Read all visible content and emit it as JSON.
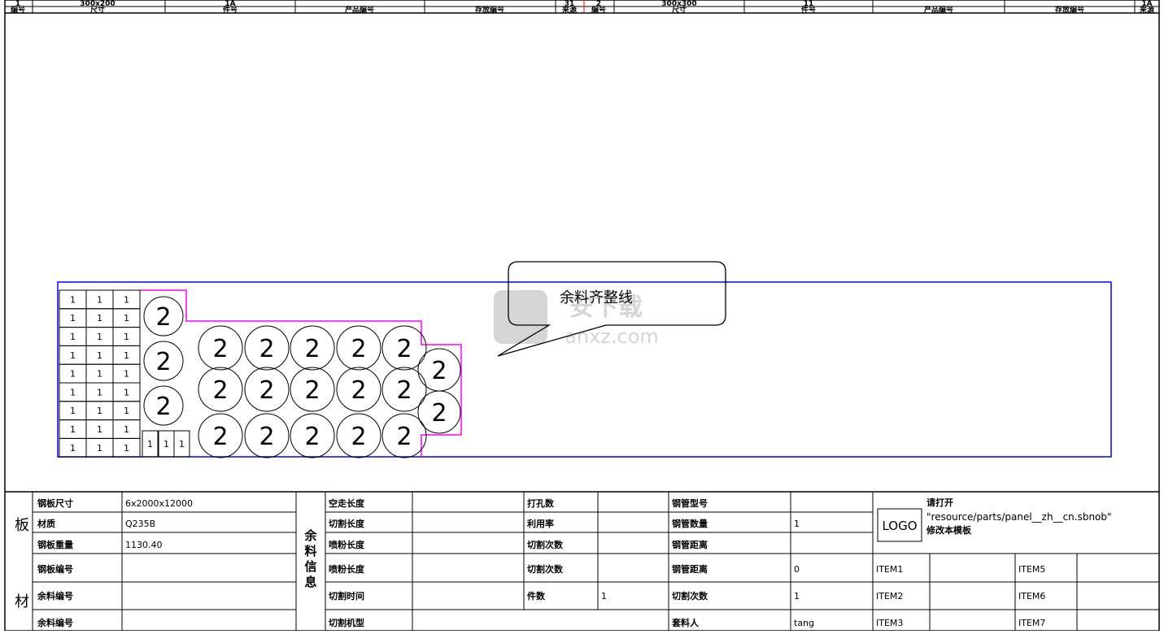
{
  "header": {
    "top_row": [
      {
        "text": "1"
      },
      {
        "text": "300x200"
      },
      {
        "text": "1A"
      },
      {
        "text": "31"
      },
      {
        "text": "2"
      },
      {
        "text": "300x300"
      },
      {
        "text": "11"
      },
      {
        "text": "1A"
      }
    ],
    "columns": [
      {
        "text": "编号"
      },
      {
        "text": "尺寸"
      },
      {
        "text": "件号"
      },
      {
        "text": "产品编号"
      },
      {
        "text": "存放编号"
      },
      {
        "text": "来源"
      },
      {
        "text": "编号"
      },
      {
        "text": "尺寸"
      },
      {
        "text": "件号"
      },
      {
        "text": "产品编号"
      },
      {
        "text": "存放编号"
      },
      {
        "text": "来源"
      }
    ]
  },
  "nesting": {
    "small_label": "1",
    "round_label": "2",
    "callout": "余料齐整线",
    "watermark_main": "安下载",
    "watermark_sub": "anxz.com"
  },
  "info_table": {
    "side_label_top": "板",
    "side_label_bottom": "材",
    "mid_label": [
      "余",
      "料",
      "信",
      "息"
    ],
    "left": [
      {
        "label": "钢板尺寸",
        "value": "6x2000x12000"
      },
      {
        "label": "材质",
        "value": "Q235B"
      },
      {
        "label": "钢板重量",
        "value": "1130.40"
      },
      {
        "label": "钢板编号",
        "value": ""
      },
      {
        "label": "余料编号",
        "value": ""
      }
    ],
    "middle1": [
      {
        "label": "空走长度",
        "value": ""
      },
      {
        "label": "切割长度",
        "value": ""
      },
      {
        "label": "喷粉长度",
        "value": ""
      },
      {
        "label": "切割时间",
        "value": ""
      },
      {
        "label": "切割机型",
        "value": ""
      }
    ],
    "middle2": [
      {
        "label": "打孔数",
        "value": ""
      },
      {
        "label": "利用率",
        "value": ""
      },
      {
        "label": "切割次数",
        "value": ""
      },
      {
        "label": "件数",
        "value": "1"
      }
    ],
    "middle3": [
      {
        "label": "钢管型号",
        "value": ""
      },
      {
        "label": "钢管数量",
        "value": "1"
      },
      {
        "label": "钢管距离",
        "value": "0"
      },
      {
        "label": "切割次数",
        "value": "1"
      },
      {
        "label": "套料人",
        "value": "tang"
      }
    ],
    "logo": "LOGO",
    "logo_note_1": "请打开",
    "logo_note_2": "\"resource/parts/panel__zh__cn.sbnob\"",
    "logo_note_3": "修改本模板",
    "items": [
      {
        "label": "ITEM1",
        "value": ""
      },
      {
        "label": "ITEM2",
        "value": ""
      },
      {
        "label": "ITEM3",
        "value": ""
      },
      {
        "label": "ITEM5",
        "value": ""
      },
      {
        "label": "ITEM6",
        "value": ""
      },
      {
        "label": "ITEM7",
        "value": ""
      }
    ]
  },
  "colors": {
    "sheet_border": "#0000ff",
    "remnant_line": "#ff00ff",
    "grid": "#000000"
  }
}
